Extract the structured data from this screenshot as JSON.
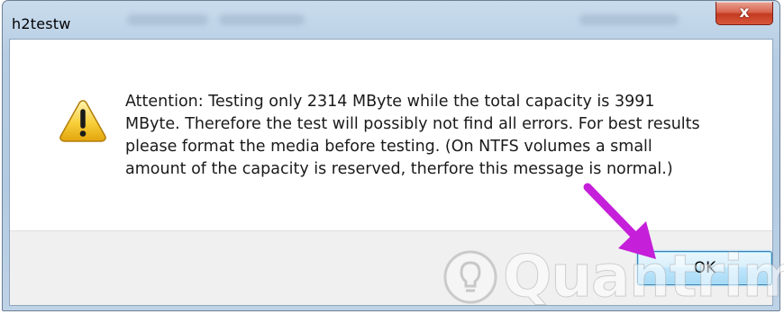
{
  "window": {
    "title": "h2testw",
    "close_label": "x"
  },
  "dialog": {
    "icon": "warning-icon",
    "message": "Attention: Testing only 2314 MByte while the total capacity is 3991\nMByte. Therefore the test will possibly not find all errors. For best results\nplease format the media before testing. (On NTFS volumes a small\namount of the capacity is reserved, therfore this message is normal.)",
    "ok_label": "OK"
  },
  "annotation": {
    "arrow_color": "#c51fd9"
  },
  "watermark": {
    "text": "Quantrimang"
  }
}
